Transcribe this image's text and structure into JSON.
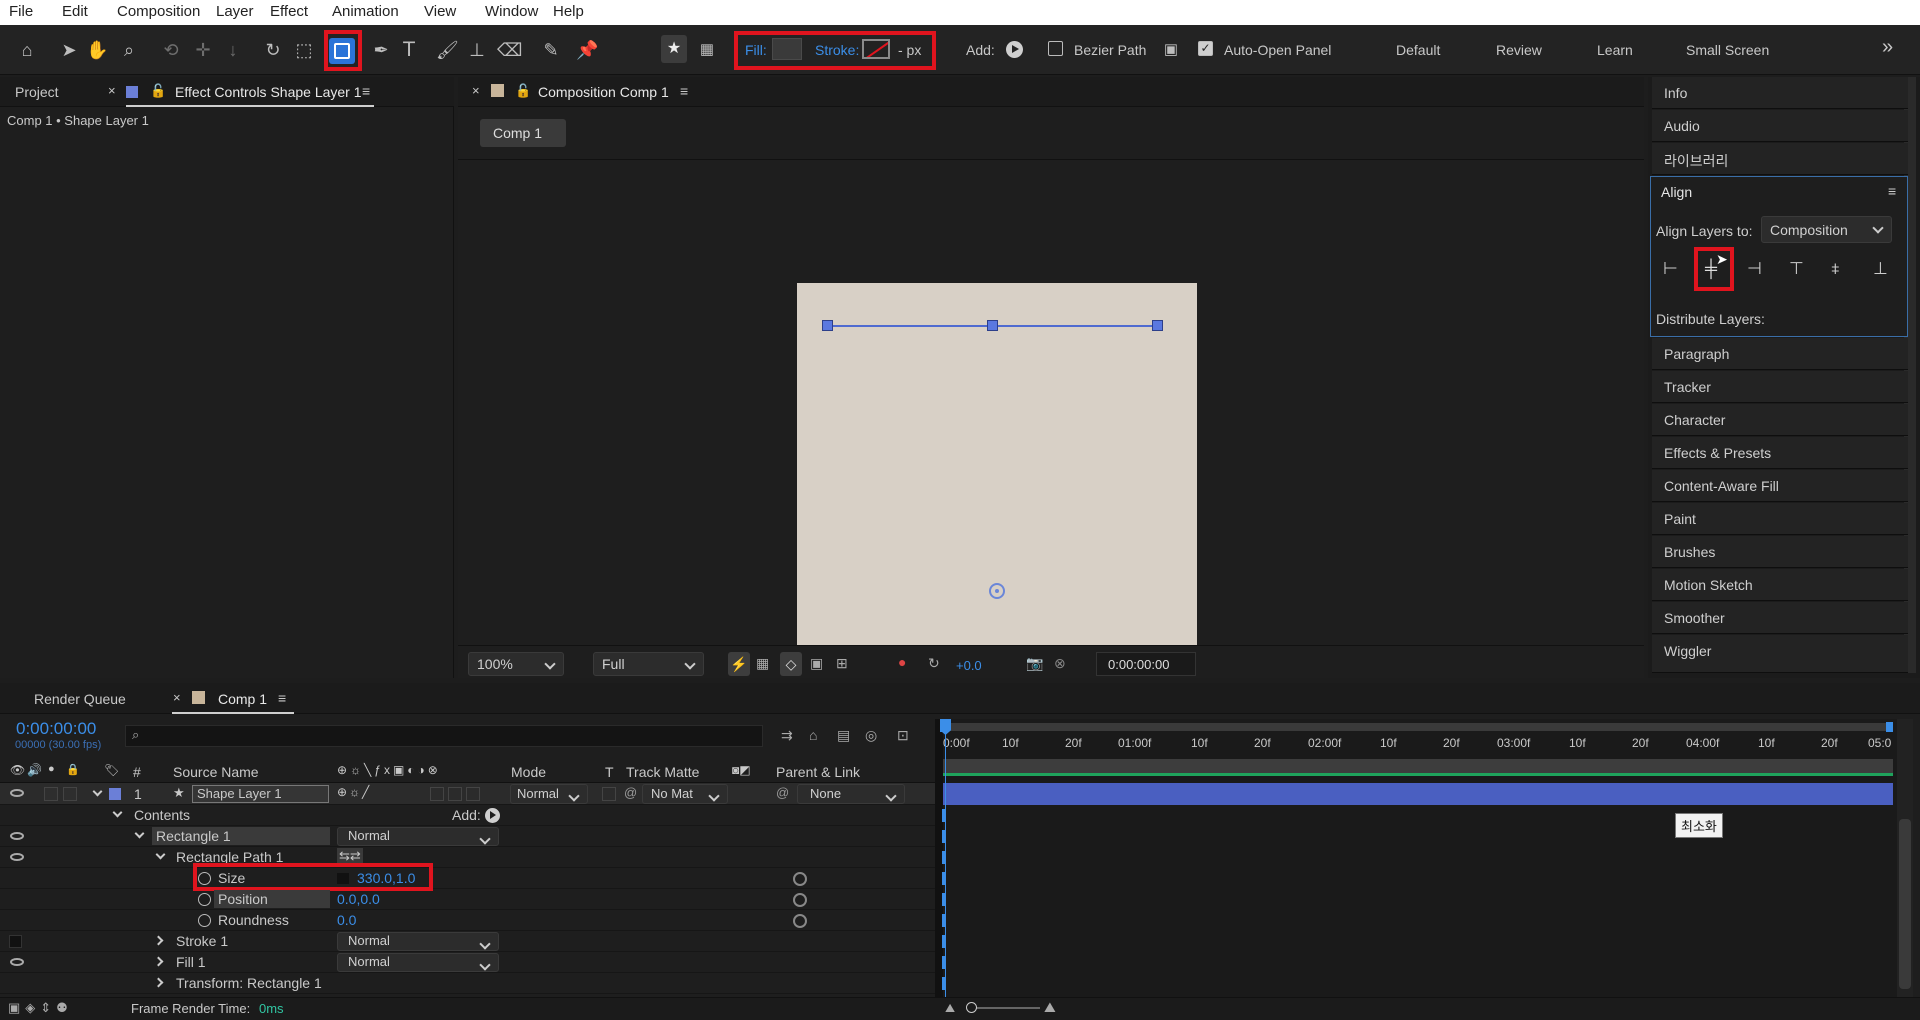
{
  "menu": [
    "File",
    "Edit",
    "Composition",
    "Layer",
    "Effect",
    "Animation",
    "View",
    "Window",
    "Help"
  ],
  "toolbar": {
    "fill_label": "Fill:",
    "stroke_label": "Stroke:",
    "stroke_px": "- px",
    "add_label": "Add:",
    "bezier_label": "Bezier Path",
    "bezier_checked": false,
    "auto_open_label": "Auto-Open Panel",
    "auto_open_checked": true,
    "workspaces": [
      "Default",
      "Review",
      "Learn",
      "Small Screen"
    ],
    "more": "»"
  },
  "left_panel": {
    "tab_project": "Project",
    "tab_effect": "Effect Controls Shape Layer 1",
    "breadcrumb": "Comp 1 • Shape Layer 1"
  },
  "comp_panel": {
    "tab": "Composition Comp 1",
    "comp_chip": "Comp 1",
    "zoom": "100%",
    "resolution": "Full",
    "exposure": "+0.0",
    "timecode": "0:00:00:00"
  },
  "right_panel": {
    "items_top": [
      "Info",
      "Audio",
      "라이브러리"
    ],
    "align_title": "Align",
    "align_to_label": "Align Layers to:",
    "align_to_value": "Composition",
    "distribute_label": "Distribute Layers:",
    "items_bottom": [
      "Paragraph",
      "Tracker",
      "Character",
      "Effects & Presets",
      "Content-Aware Fill",
      "Paint",
      "Brushes",
      "Motion Sketch",
      "Smoother",
      "Wiggler"
    ]
  },
  "timeline": {
    "tab_render": "Render Queue",
    "tab_comp": "Comp 1",
    "timecode": "0:00:00:00",
    "fps": "00000 (30.00 fps)",
    "col_num": "#",
    "col_source": "Source Name",
    "col_mode": "Mode",
    "col_t": "T",
    "col_track": "Track Matte",
    "col_parent": "Parent & Link",
    "layer_num": "1",
    "layer_name": "Shape Layer 1",
    "layer_mode": "Normal",
    "layer_matte": "No Mat",
    "layer_parent": "None",
    "contents": "Contents",
    "add_label": "Add:",
    "rect1": "Rectangle 1",
    "rect1_mode": "Normal",
    "rect_path": "Rectangle Path 1",
    "size_label": "Size",
    "size_value": "330.0,1.0",
    "position_label": "Position",
    "position_value": "0.0,0.0",
    "roundness_label": "Roundness",
    "roundness_value": "0.0",
    "stroke1": "Stroke 1",
    "stroke1_mode": "Normal",
    "fill1": "Fill 1",
    "fill1_mode": "Normal",
    "transform": "Transform: Rectangle 1",
    "frame_render_label": "Frame Render Time:",
    "frame_render_value": "0ms",
    "ruler": [
      "0:00f",
      "10f",
      "20f",
      "01:00f",
      "10f",
      "20f",
      "02:00f",
      "10f",
      "20f",
      "03:00f",
      "10f",
      "20f",
      "04:00f",
      "10f",
      "20f",
      "05:0"
    ],
    "tooltip": "최소화"
  },
  "colors": {
    "accent": "#3b8ee8",
    "highlight": "#e0141e",
    "layer_bar": "#4a5fc1",
    "canvas": "#d8d0c6"
  }
}
